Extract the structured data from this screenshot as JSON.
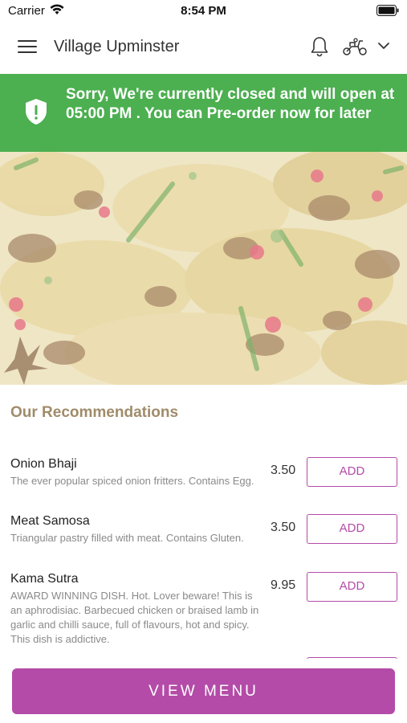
{
  "status_bar": {
    "carrier": "Carrier",
    "time": "8:54 PM"
  },
  "header": {
    "title": "Village Upminster",
    "icons": [
      "menu-icon",
      "bell-icon",
      "scooter-icon",
      "chevron-down-icon"
    ]
  },
  "banner": {
    "message": "Sorry, We're currently closed and will open at 05:00 PM . You can Pre-order now for later",
    "color": "#4caf50",
    "icon": "shield-alert-icon"
  },
  "recommendations": {
    "title": "Our Recommendations",
    "items": [
      {
        "name": "Onion Bhaji",
        "description": "The ever popular spiced onion fritters. Contains Egg.",
        "price": "3.50",
        "button": "ADD"
      },
      {
        "name": "Meat Samosa",
        "description": "Triangular pastry filled with meat. Contains Gluten.",
        "price": "3.50",
        "button": "ADD"
      },
      {
        "name": "Kama Sutra",
        "description": "AWARD WINNING DISH. Hot. Lover beware! This is an aphrodisiac. Barbecued chicken or braised lamb in garlic and chilli sauce, full of flavours, hot and spicy. This dish is addictive.",
        "price": "9.95",
        "button": "ADD"
      }
    ]
  },
  "footer": {
    "view_menu_label": "VIEW MENU"
  },
  "colors": {
    "accent": "#b44ba8",
    "banner": "#4caf50",
    "section_title": "#a08c6a"
  }
}
